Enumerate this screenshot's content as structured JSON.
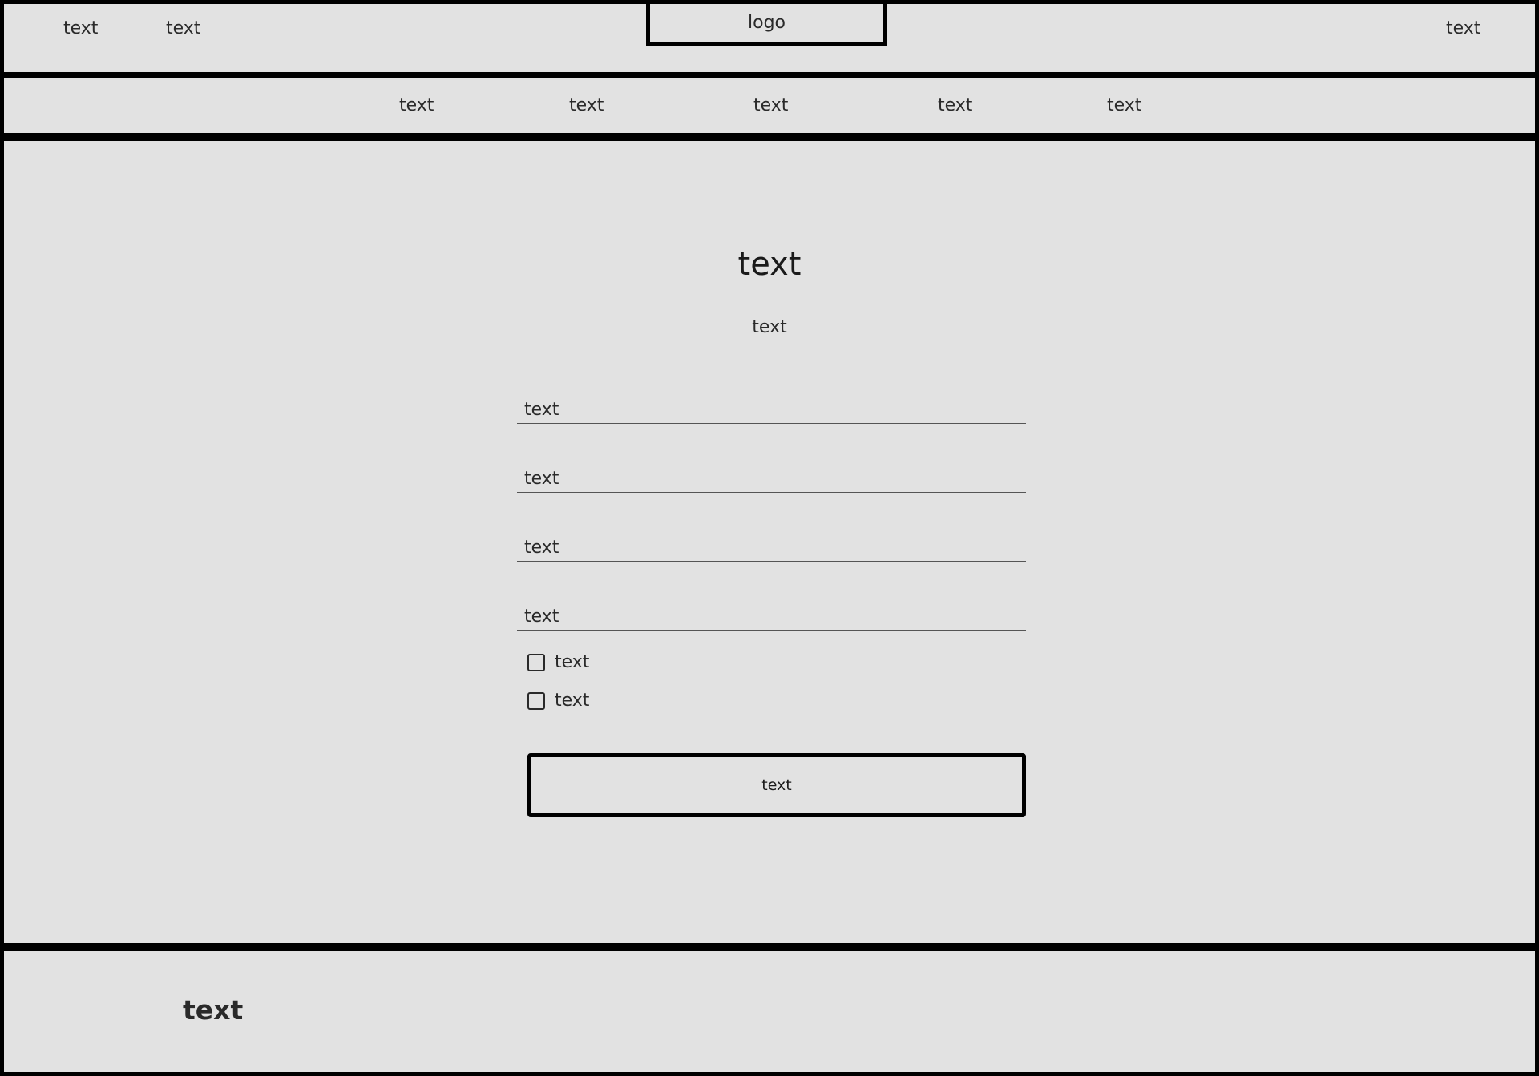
{
  "top_bar": {
    "left_links": [
      "text",
      "text"
    ],
    "logo": "logo",
    "right_link": "text"
  },
  "nav": {
    "items": [
      "text",
      "text",
      "text",
      "text",
      "text"
    ]
  },
  "form": {
    "title": "text",
    "subtitle": "text",
    "fields": [
      "text",
      "text",
      "text",
      "text"
    ],
    "checkboxes": [
      "text",
      "text"
    ],
    "submit_label": "text"
  },
  "footer": {
    "text": "text"
  }
}
